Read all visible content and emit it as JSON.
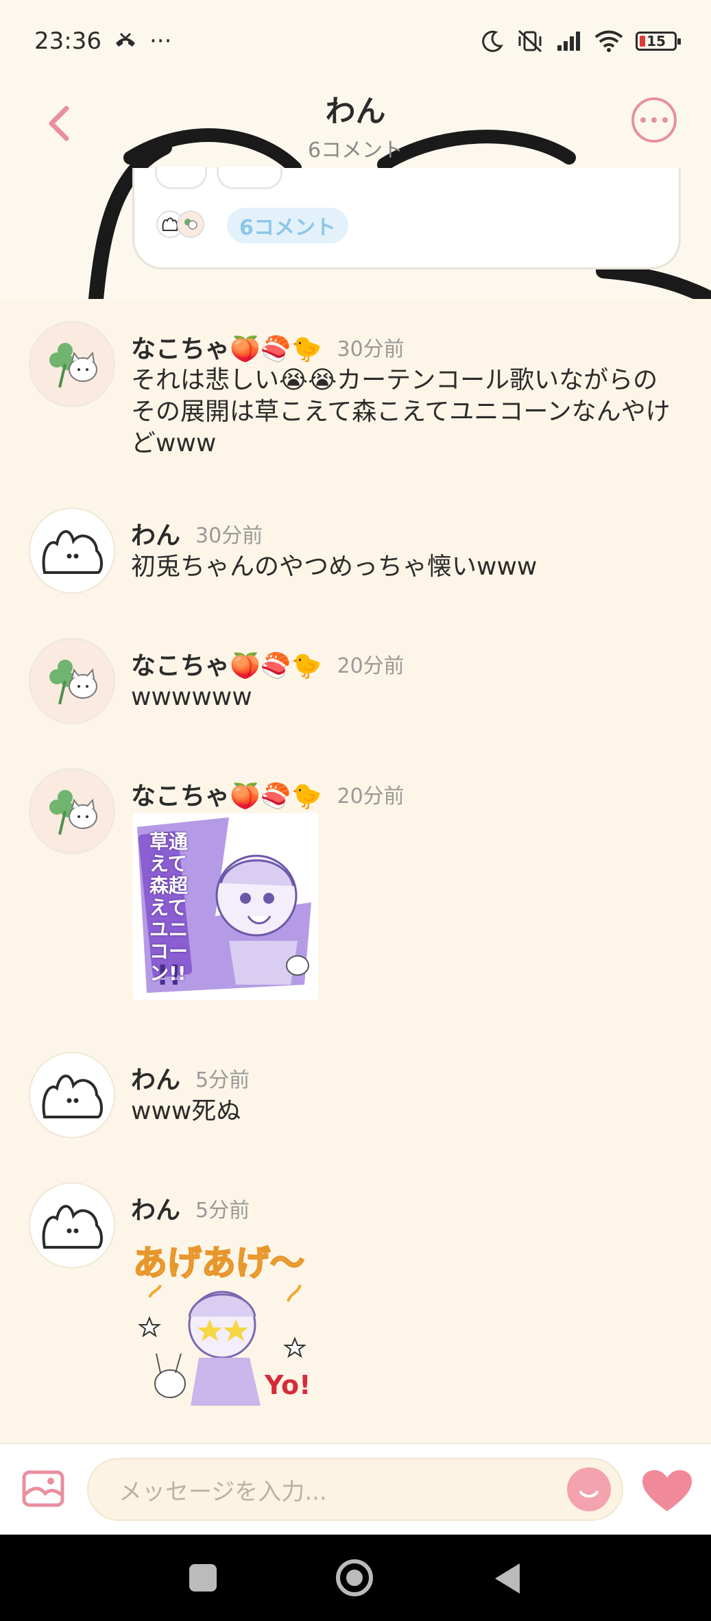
{
  "status_bar": {
    "time": "23:36",
    "extra": "···",
    "battery": "15"
  },
  "header": {
    "title": "わん",
    "subtitle": "6コメント"
  },
  "post_card": {
    "comment_count_label": "6コメント"
  },
  "comments": [
    {
      "name": "なこちゃ🍑🍣🐤",
      "time": "30分前",
      "text": "それは悲しい😭😭カーテンコール歌いながらのその展開は草こえて森こえてユニコーンなんやけどwww"
    },
    {
      "name": "わん",
      "time": "30分前",
      "text": "初兎ちゃんのやつめっちゃ懐いwww"
    },
    {
      "name": "なこちゃ🍑🍣🐤",
      "time": "20分前",
      "text": "wwwwww"
    },
    {
      "name": "なこちゃ🍑🍣🐤",
      "time": "20分前",
      "sticker_text": "草通えて森超えてユニコーン!!"
    },
    {
      "name": "わん",
      "time": "5分前",
      "text": "www死ぬ"
    },
    {
      "name": "わん",
      "time": "5分前",
      "sticker_text": "あげあげ〜",
      "sticker_tag": "Yo!"
    }
  ],
  "input": {
    "placeholder": "メッセージを入力..."
  },
  "colors": {
    "accent_pink": "#e98fa0",
    "background": "#fdf6e8",
    "pill_blue": "#8cc6ea"
  }
}
